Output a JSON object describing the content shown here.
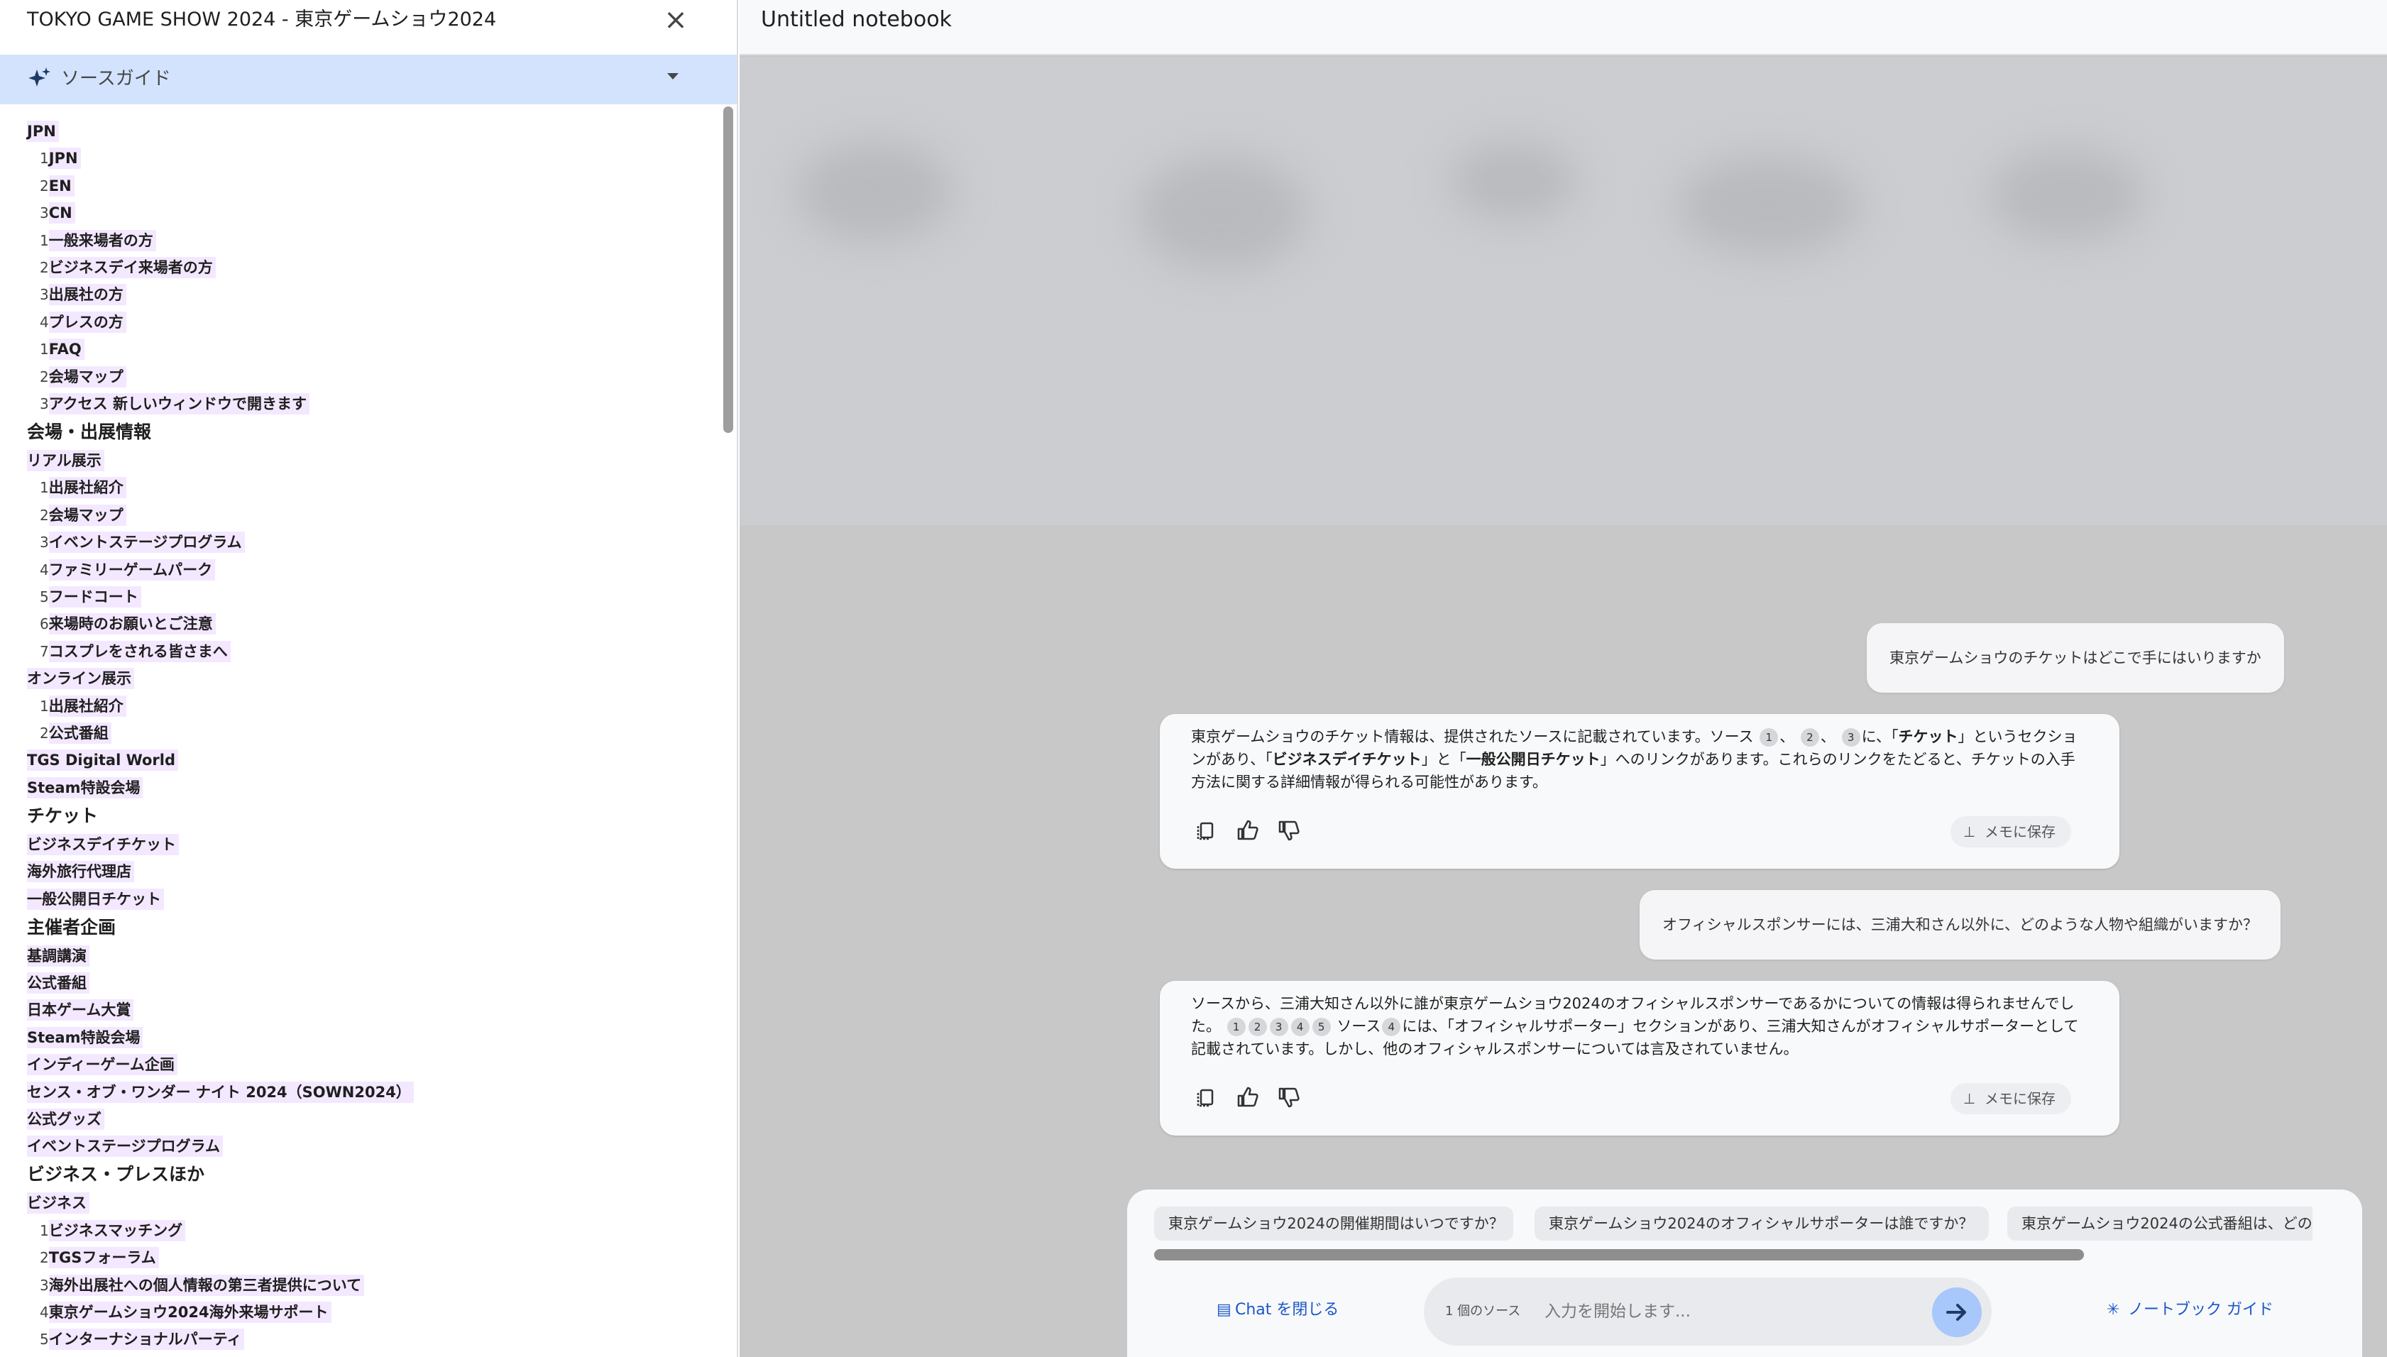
{
  "left_panel": {
    "title": "TOKYO GAME SHOW 2024 - 東京ゲームショウ2024",
    "guide_label": "ソースガイド",
    "outline": [
      {
        "num": "",
        "text": "JPN",
        "level": 0
      },
      {
        "num": "1",
        "text": "JPN",
        "level": 1
      },
      {
        "num": "2",
        "text": "EN",
        "level": 1
      },
      {
        "num": "3",
        "text": "CN",
        "level": 1
      },
      {
        "num": "1",
        "text": "一般来場者の方",
        "level": 1
      },
      {
        "num": "2",
        "text": "ビジネスデイ来場者の方",
        "level": 1
      },
      {
        "num": "3",
        "text": "出展社の方",
        "level": 1
      },
      {
        "num": "4",
        "text": "プレスの方",
        "level": 1
      },
      {
        "num": "1",
        "text": "FAQ",
        "level": 1
      },
      {
        "num": "2",
        "text": "会場マップ",
        "level": 1
      },
      {
        "num": "3",
        "text": "アクセス 新しいウィンドウで開きます",
        "level": 1
      },
      {
        "num": "",
        "text": "会場・出展情報",
        "level": 2
      },
      {
        "num": "",
        "text": "リアル展示",
        "level": 0
      },
      {
        "num": "1",
        "text": "出展社紹介",
        "level": 1
      },
      {
        "num": "2",
        "text": "会場マップ",
        "level": 1
      },
      {
        "num": "3",
        "text": "イベントステージプログラム",
        "level": 1
      },
      {
        "num": "4",
        "text": "ファミリーゲームパーク",
        "level": 1
      },
      {
        "num": "5",
        "text": "フードコート",
        "level": 1
      },
      {
        "num": "6",
        "text": "来場時のお願いとご注意",
        "level": 1
      },
      {
        "num": "7",
        "text": "コスプレをされる皆さまへ",
        "level": 1
      },
      {
        "num": "",
        "text": "オンライン展示",
        "level": 0
      },
      {
        "num": "1",
        "text": "出展社紹介",
        "level": 1
      },
      {
        "num": "2",
        "text": "公式番組",
        "level": 1
      },
      {
        "num": "",
        "text": "TGS Digital World",
        "level": 0
      },
      {
        "num": "",
        "text": "Steam特設会場",
        "level": 0
      },
      {
        "num": "",
        "text": "チケット",
        "level": 2
      },
      {
        "num": "",
        "text": "ビジネスデイチケット",
        "level": 0
      },
      {
        "num": "",
        "text": "海外旅行代理店",
        "level": 0
      },
      {
        "num": "",
        "text": "一般公開日チケット",
        "level": 0
      },
      {
        "num": "",
        "text": "主催者企画",
        "level": 2
      },
      {
        "num": "",
        "text": "基調講演",
        "level": 0
      },
      {
        "num": "",
        "text": "公式番組",
        "level": 0
      },
      {
        "num": "",
        "text": "日本ゲーム大賞",
        "level": 0
      },
      {
        "num": "",
        "text": "Steam特設会場",
        "level": 0
      },
      {
        "num": "",
        "text": "インディーゲーム企画",
        "level": 0
      },
      {
        "num": "",
        "text": "センス・オブ・ワンダー ナイト 2024（SOWN2024）",
        "level": 0
      },
      {
        "num": "",
        "text": "公式グッズ",
        "level": 0
      },
      {
        "num": "",
        "text": "イベントステージプログラム",
        "level": 0
      },
      {
        "num": "",
        "text": "ビジネス・プレスほか",
        "level": 2
      },
      {
        "num": "",
        "text": "ビジネス",
        "level": 0
      },
      {
        "num": "1",
        "text": "ビジネスマッチング",
        "level": 1
      },
      {
        "num": "2",
        "text": "TGSフォーラム",
        "level": 1
      },
      {
        "num": "3",
        "text": "海外出展社への個人情報の第三者提供について",
        "level": 1
      },
      {
        "num": "4",
        "text": "東京ゲームショウ2024海外来場サポート",
        "level": 1
      },
      {
        "num": "5",
        "text": "インターナショナルパーティ",
        "level": 1
      }
    ]
  },
  "notebook": {
    "title": "Untitled notebook"
  },
  "chat": {
    "q1": "東京ゲームショウのチケットはどこで手にはいりますか",
    "a1": {
      "p1": "東京ゲームショウのチケット情報は、提供されたソースに記載されています。ソース",
      "c1": "1",
      "sep1": "、",
      "c2": "2",
      "sep2": "、",
      "c3": "3",
      "p2": "に、「",
      "b1": "チケット",
      "p3": "」というセクションがあり、「",
      "b2": "ビジネスデイチケット",
      "p4": "」と「",
      "b3": "一般公開日チケット",
      "p5": "」へのリンクがあります。これらのリンクをたどると、チケットの入手方法に関する詳細情報が得られる可能性があります。"
    },
    "q2": "オフィシャルスポンサーには、三浦大和さん以外に、どのような人物や組織がいますか？",
    "a2": {
      "p1": "ソースから、三浦大知さん以外に誰が東京ゲームショウ2024のオフィシャルスポンサーであるかについての情報は得られませんでした。",
      "c1": "1",
      "c2": "2",
      "c3": "3",
      "c4": "4",
      "c5": "5",
      "p2": "ソース",
      "c6": "4",
      "p3": "には、「オフィシャルサポーター」セクションがあり、三浦大知さんがオフィシャルサポーターとして記載されています。しかし、他のオフィシャルスポンサーについては言及されていません。"
    },
    "save_label": "メモに保存"
  },
  "composer": {
    "suggestions": [
      "東京ゲームショウ2024の開催期間はいつですか？",
      "東京ゲームショウ2024のオフィシャルサポーターは誰ですか？",
      "東京ゲームショウ2024の公式番組は、どの"
    ],
    "close_chat": "Chat を閉じる",
    "source_count": "1 個のソース",
    "input_placeholder": "入力を開始します...",
    "notebook_guide": "ノートブック ガイド"
  },
  "colors": {
    "guide_bar": "#d3e3fd",
    "highlight": "#f3e8ff",
    "accent": "#1a56c9",
    "send": "#a8c7fa"
  }
}
